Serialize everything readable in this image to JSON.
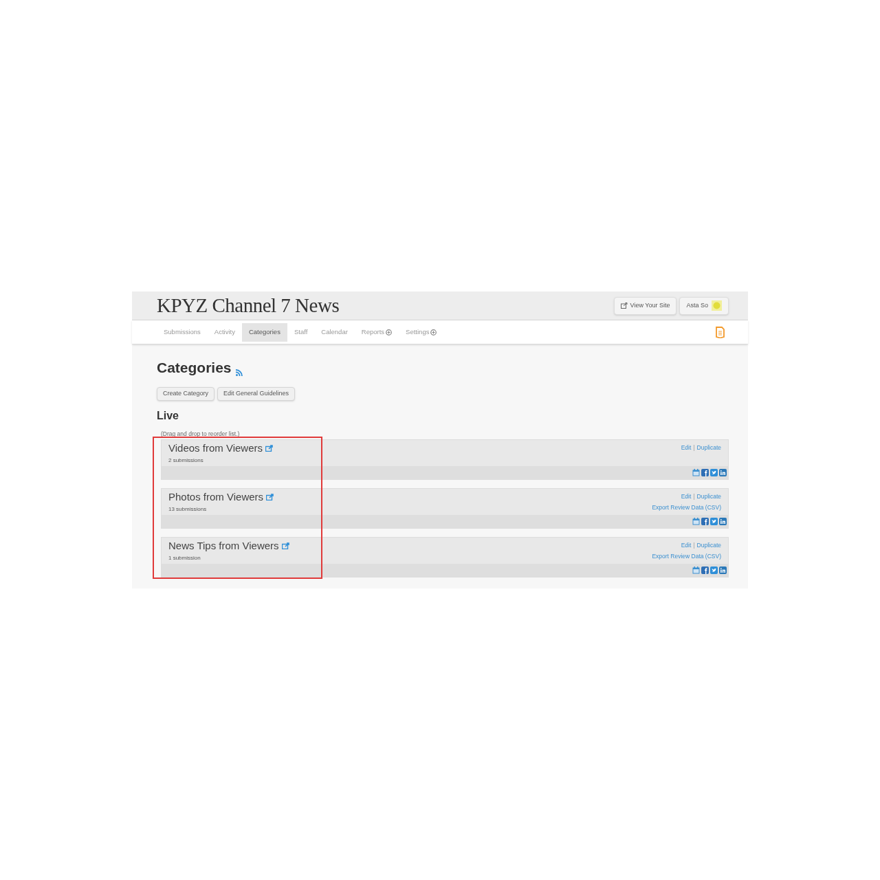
{
  "header": {
    "site_title": "KPYZ Channel 7 News",
    "view_site_button": "View Your Site",
    "user_button": "Asta So"
  },
  "nav": {
    "tabs": [
      {
        "label": "Submissions",
        "selected": false,
        "menu": false
      },
      {
        "label": "Activity",
        "selected": false,
        "menu": false
      },
      {
        "label": "Categories",
        "selected": true,
        "menu": false
      },
      {
        "label": "Staff",
        "selected": false,
        "menu": false
      },
      {
        "label": "Calendar",
        "selected": false,
        "menu": false
      },
      {
        "label": "Reports",
        "selected": false,
        "menu": true
      },
      {
        "label": "Settings",
        "selected": false,
        "menu": true
      }
    ]
  },
  "page": {
    "title": "Categories",
    "buttons": [
      "Create Category",
      "Edit General Guidelines"
    ],
    "section_title": "Live",
    "hint": "(Drag and drop to reorder list.)"
  },
  "categories": [
    {
      "title": "Videos from Viewers",
      "count": "2 submissions",
      "edit": "Edit",
      "separator": "|",
      "duplicate": "Duplicate"
    },
    {
      "title": "Photos from Viewers",
      "count": "13 submissions",
      "edit": "Edit",
      "separator": "|",
      "duplicate": "Duplicate",
      "export": "Export Review Data (CSV)"
    },
    {
      "title": "News Tips from Viewers",
      "count": "1 submission",
      "edit": "Edit",
      "separator": "|",
      "duplicate": "Duplicate",
      "export": "Export Review Data (CSV)"
    }
  ],
  "highlight": {
    "shown": true
  }
}
